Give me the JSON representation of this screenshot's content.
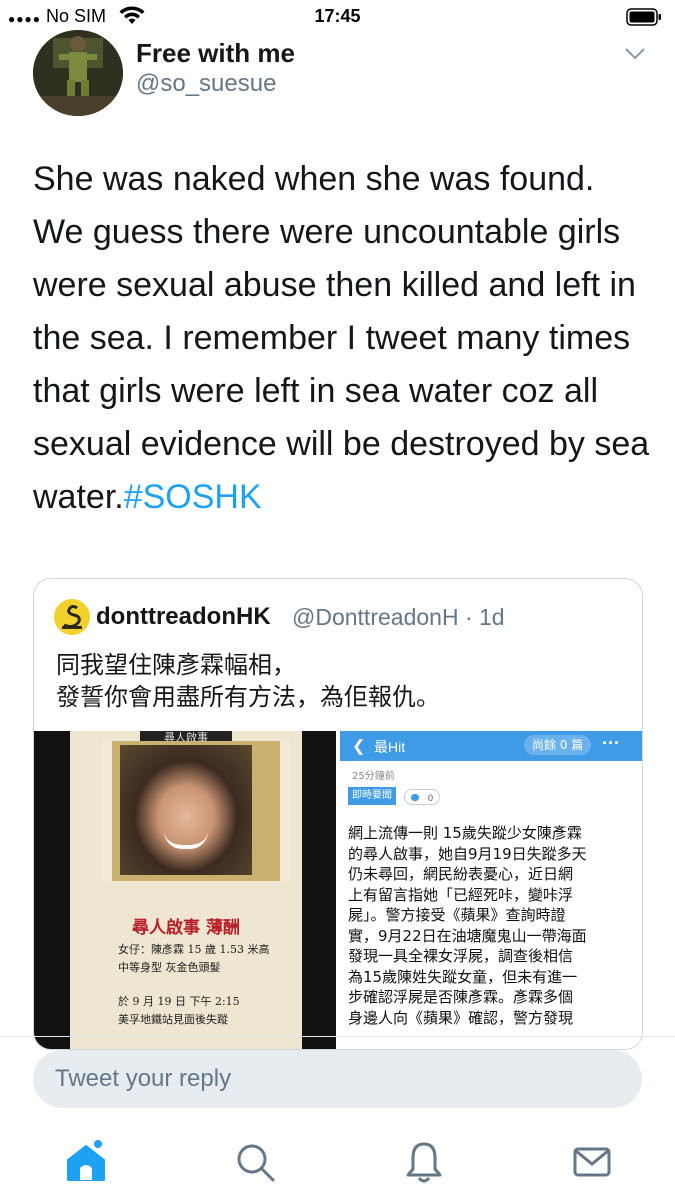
{
  "status_bar": {
    "signal": "●●●●",
    "carrier": "No SIM",
    "time": "17:45",
    "wifi_icon": "wifi-icon",
    "battery_icon": "battery-icon"
  },
  "tweet": {
    "author_name": "Free with me",
    "author_handle": "@so_suesue",
    "text": "She was naked when she was found. We guess there were uncountable girls were sexual abuse then killed and left in the sea. I remember I tweet many times that girls were left in sea water coz all sexual evidence will be destroyed by sea water.",
    "hashtag": "#SOSHK",
    "menu_icon": "chevron-down-icon"
  },
  "quoted_tweet": {
    "author_name": "donttreadonHK",
    "author_handle": "@DonttreadonH · 1d",
    "text_line1": "同我望住陳彥霖幅相，",
    "text_line2": "發誓你會用盡所有方法，為佢報仇。",
    "poster": {
      "top_banner": "尋人啟事",
      "title": "尋人啟事  薄酬",
      "line1": "女仔：陳彥霖    15 歲  1.53 米高",
      "line2": "中等身型  灰金色頭髮",
      "line3": "於 9 月 19 日  下午 2:15",
      "line4": "美孚地鐵站見面後失蹤"
    },
    "article": {
      "back_label": "❮",
      "app_title": "最Hit",
      "remaining": "尚餘 0 篇",
      "more": "···",
      "time": "25分鐘前",
      "tag": "即時要聞",
      "comments": "0",
      "lines": [
        "網上流傳一則 15歲失蹤少女陳彥霖",
        "的尋人啟事，她自9月19日失蹤多天",
        "仍未尋回，網民紛表憂心，近日網",
        "上有留言指她「已經死咔，變咔浮",
        "屍」。警方接受《蘋果》查詢時證",
        "實，9月22日在油塘魔鬼山一帶海面",
        "發現一具全裸女浮屍，調查後相信",
        "為15歲陳姓失蹤女童，但未有進一",
        "步確認浮屍是否陳彥霖。彥霖多個",
        "身邊人向《蘋果》確認，警方發現"
      ]
    }
  },
  "reply": {
    "placeholder": "Tweet your reply"
  },
  "tab_bar": {
    "items": [
      {
        "icon": "home-icon",
        "active": true
      },
      {
        "icon": "search-icon",
        "active": false
      },
      {
        "icon": "bell-icon",
        "active": false
      },
      {
        "icon": "mail-icon",
        "active": false
      }
    ]
  },
  "colors": {
    "accent": "#1da1f2",
    "text": "#14171a",
    "secondary_text": "#657786",
    "inactive_icon": "#657786"
  }
}
